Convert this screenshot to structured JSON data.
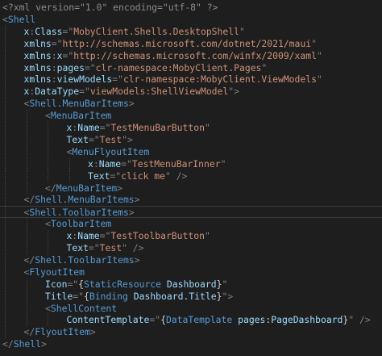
{
  "colors": {
    "background": "#1e1e1e",
    "tag": "#569cd6",
    "attribute": "#9cdcfe",
    "string": "#ce9178",
    "punctuation": "#808080",
    "declaration": "#8c8c8c",
    "markup_extension": "#d4d4d4"
  },
  "lines": [
    {
      "indent": 0,
      "tokens": [
        [
          "decl",
          "<?xml version=\"1.0\" encoding=\"utf-8\" ?>"
        ]
      ]
    },
    {
      "indent": 0,
      "tokens": [
        [
          "punc",
          "<"
        ],
        [
          "tag",
          "Shell"
        ]
      ]
    },
    {
      "indent": 1,
      "tokens": [
        [
          "attr",
          "x"
        ],
        [
          "punc",
          ":"
        ],
        [
          "attr",
          "Class"
        ],
        [
          "punc",
          "=\""
        ],
        [
          "str",
          "MobyClient.Shells.DesktopShell"
        ],
        [
          "punc",
          "\""
        ]
      ]
    },
    {
      "indent": 1,
      "tokens": [
        [
          "attr",
          "xmlns"
        ],
        [
          "punc",
          "=\""
        ],
        [
          "str",
          "http://schemas.microsoft.com/dotnet/2021/maui"
        ],
        [
          "punc",
          "\""
        ]
      ]
    },
    {
      "indent": 1,
      "tokens": [
        [
          "attr",
          "xmlns"
        ],
        [
          "punc",
          ":"
        ],
        [
          "attr",
          "x"
        ],
        [
          "punc",
          "=\""
        ],
        [
          "str",
          "http://schemas.microsoft.com/winfx/2009/xaml"
        ],
        [
          "punc",
          "\""
        ]
      ]
    },
    {
      "indent": 1,
      "tokens": [
        [
          "attr",
          "xmlns"
        ],
        [
          "punc",
          ":"
        ],
        [
          "attr",
          "pages"
        ],
        [
          "punc",
          "=\""
        ],
        [
          "str",
          "clr-namespace:MobyClient.Pages"
        ],
        [
          "punc",
          "\""
        ]
      ]
    },
    {
      "indent": 1,
      "tokens": [
        [
          "attr",
          "xmlns"
        ],
        [
          "punc",
          ":"
        ],
        [
          "attr",
          "viewModels"
        ],
        [
          "punc",
          "=\""
        ],
        [
          "str",
          "clr-namespace:MobyClient.ViewModels"
        ],
        [
          "punc",
          "\""
        ]
      ]
    },
    {
      "indent": 1,
      "tokens": [
        [
          "attr",
          "x"
        ],
        [
          "punc",
          ":"
        ],
        [
          "attr",
          "DataType"
        ],
        [
          "punc",
          "=\""
        ],
        [
          "str",
          "viewModels:ShellViewModel"
        ],
        [
          "punc",
          "\">"
        ]
      ]
    },
    {
      "indent": 1,
      "tokens": [
        [
          "punc",
          "<"
        ],
        [
          "tag",
          "Shell.MenuBarItems"
        ],
        [
          "punc",
          ">"
        ]
      ]
    },
    {
      "indent": 2,
      "tokens": [
        [
          "punc",
          "<"
        ],
        [
          "tag",
          "MenuBarItem"
        ]
      ]
    },
    {
      "indent": 3,
      "tokens": [
        [
          "attr",
          "x"
        ],
        [
          "punc",
          ":"
        ],
        [
          "attr",
          "Name"
        ],
        [
          "punc",
          "=\""
        ],
        [
          "str",
          "TestMenuBarButton"
        ],
        [
          "punc",
          "\""
        ]
      ]
    },
    {
      "indent": 3,
      "tokens": [
        [
          "attr",
          "Text"
        ],
        [
          "punc",
          "=\""
        ],
        [
          "str",
          "Test"
        ],
        [
          "punc",
          "\">"
        ]
      ]
    },
    {
      "indent": 3,
      "tokens": [
        [
          "punc",
          "<"
        ],
        [
          "tag",
          "MenuFlyoutItem"
        ]
      ]
    },
    {
      "indent": 4,
      "tokens": [
        [
          "attr",
          "x"
        ],
        [
          "punc",
          ":"
        ],
        [
          "attr",
          "Name"
        ],
        [
          "punc",
          "=\""
        ],
        [
          "str",
          "TestMenuBarInner"
        ],
        [
          "punc",
          "\""
        ]
      ]
    },
    {
      "indent": 4,
      "tokens": [
        [
          "attr",
          "Text"
        ],
        [
          "punc",
          "=\""
        ],
        [
          "str",
          "click me"
        ],
        [
          "punc",
          "\" />"
        ]
      ]
    },
    {
      "indent": 2,
      "tokens": [
        [
          "punc",
          "</"
        ],
        [
          "tag",
          "MenuBarItem"
        ],
        [
          "punc",
          ">"
        ]
      ]
    },
    {
      "indent": 1,
      "tokens": [
        [
          "punc",
          "</"
        ],
        [
          "tag",
          "Shell.MenuBarItems"
        ],
        [
          "punc",
          ">"
        ]
      ]
    },
    {
      "indent": 1,
      "current": true,
      "tokens": [
        [
          "punc",
          "<"
        ],
        [
          "tag",
          "Shell.ToolbarItems"
        ],
        [
          "punc",
          ">"
        ]
      ]
    },
    {
      "indent": 2,
      "tokens": [
        [
          "punc",
          "<"
        ],
        [
          "tag",
          "ToolbarItem"
        ]
      ]
    },
    {
      "indent": 3,
      "tokens": [
        [
          "attr",
          "x"
        ],
        [
          "punc",
          ":"
        ],
        [
          "attr",
          "Name"
        ],
        [
          "punc",
          "=\""
        ],
        [
          "str",
          "TestToolbarButton"
        ],
        [
          "punc",
          "\""
        ]
      ]
    },
    {
      "indent": 3,
      "tokens": [
        [
          "attr",
          "Text"
        ],
        [
          "punc",
          "=\""
        ],
        [
          "str",
          "Test"
        ],
        [
          "punc",
          "\" />"
        ]
      ]
    },
    {
      "indent": 1,
      "tokens": [
        [
          "punc",
          "</"
        ],
        [
          "tag",
          "Shell.ToolbarItems"
        ],
        [
          "punc",
          ">"
        ]
      ]
    },
    {
      "indent": 1,
      "tokens": [
        [
          "punc",
          "<"
        ],
        [
          "tag",
          "FlyoutItem"
        ]
      ]
    },
    {
      "indent": 2,
      "tokens": [
        [
          "attr",
          "Icon"
        ],
        [
          "punc",
          "=\""
        ],
        [
          "ext",
          "{"
        ],
        [
          "tag",
          "StaticResource"
        ],
        [
          "ext",
          " "
        ],
        [
          "attr",
          "Dashboard"
        ],
        [
          "ext",
          "}"
        ],
        [
          "punc",
          "\""
        ]
      ]
    },
    {
      "indent": 2,
      "tokens": [
        [
          "attr",
          "Title"
        ],
        [
          "punc",
          "=\""
        ],
        [
          "ext",
          "{"
        ],
        [
          "tag",
          "Binding"
        ],
        [
          "ext",
          " "
        ],
        [
          "attr",
          "Dashboard.Title"
        ],
        [
          "ext",
          "}"
        ],
        [
          "punc",
          "\">"
        ]
      ]
    },
    {
      "indent": 2,
      "tokens": [
        [
          "punc",
          "<"
        ],
        [
          "tag",
          "ShellContent"
        ]
      ]
    },
    {
      "indent": 3,
      "tokens": [
        [
          "attr",
          "ContentTemplate"
        ],
        [
          "punc",
          "=\""
        ],
        [
          "ext",
          "{"
        ],
        [
          "tag",
          "DataTemplate"
        ],
        [
          "ext",
          " "
        ],
        [
          "attr",
          "pages"
        ],
        [
          "ext",
          ":"
        ],
        [
          "attr",
          "PageDashboard"
        ],
        [
          "ext",
          "}"
        ],
        [
          "punc",
          "\" />"
        ]
      ]
    },
    {
      "indent": 1,
      "tokens": [
        [
          "punc",
          "</"
        ],
        [
          "tag",
          "FlyoutItem"
        ],
        [
          "punc",
          ">"
        ]
      ]
    },
    {
      "indent": 0,
      "tokens": [
        [
          "punc",
          "</"
        ],
        [
          "tag",
          "Shell"
        ],
        [
          "punc",
          ">"
        ]
      ]
    }
  ]
}
